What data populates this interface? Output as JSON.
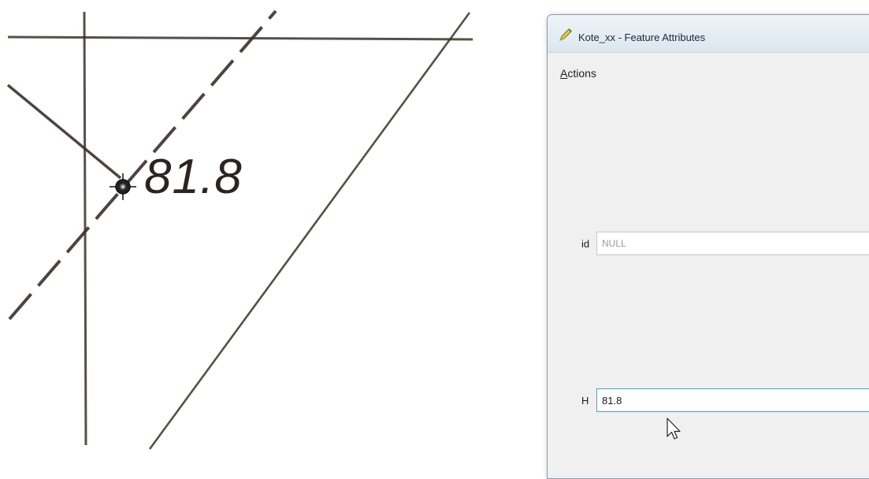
{
  "map": {
    "label": "81.8",
    "marker_icon": "crosshair-marker-icon",
    "line_color": "#3b302a"
  },
  "dialog": {
    "title": "Kote_xx - Feature Attributes",
    "icon": "pencil-edit-icon",
    "menu": {
      "actions_accel": "A",
      "actions_rest": "ctions"
    },
    "fields": {
      "id": {
        "label": "id",
        "value": "NULL"
      },
      "h": {
        "label": "H",
        "value": "81.8"
      }
    }
  },
  "pointer": {
    "icon": "mouse-pointer-icon"
  }
}
